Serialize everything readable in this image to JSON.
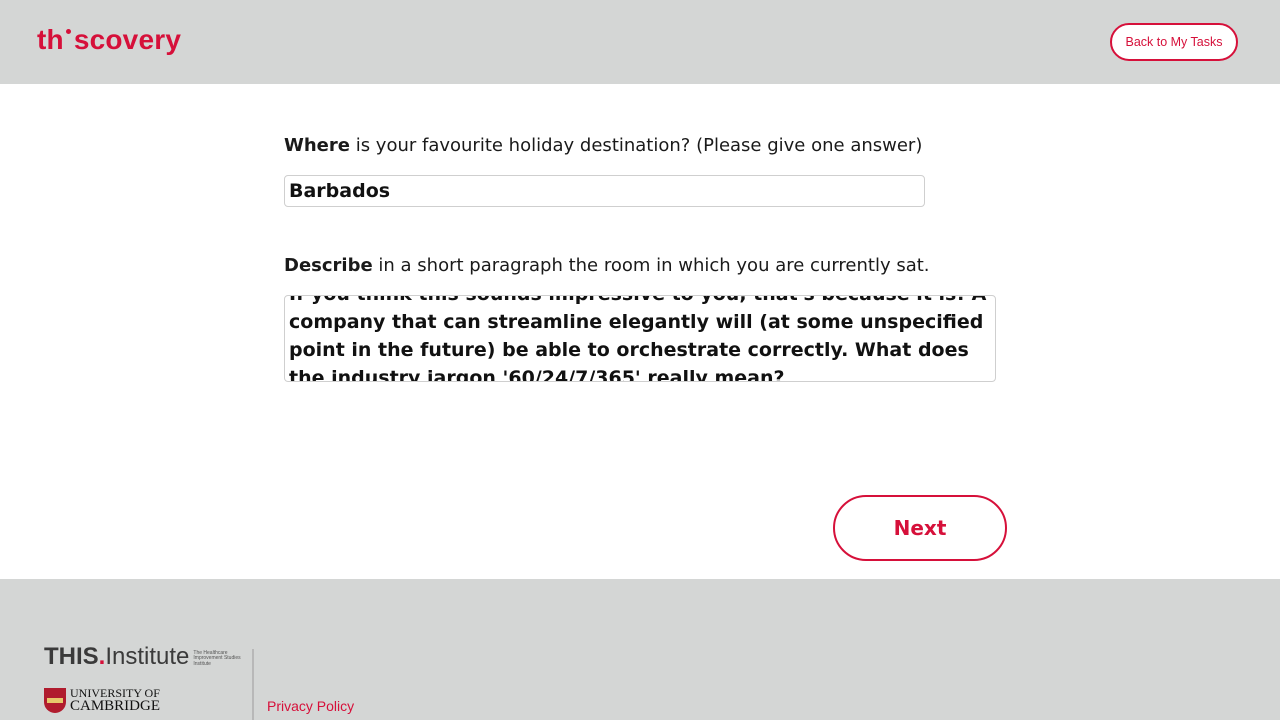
{
  "header": {
    "logo_text_left": "th",
    "logo_text_right": "scovery",
    "back_button_label": "Back to My Tasks"
  },
  "questions": [
    {
      "bold": "Where",
      "rest": " is your favourite holiday destination? (Please give one answer)",
      "answer": "Barbados"
    },
    {
      "bold": "Describe",
      "rest": " in a short paragraph the room in which you are currently sat.",
      "answer": "If you think this sounds impressive to you, that's because it is! A company that can streamline elegantly will (at some unspecified point in the future) be able to orchestrate correctly. What does the industry jargon '60/24/7/365' really mean?"
    }
  ],
  "next_button_label": "Next",
  "footer": {
    "this_bold": "THIS",
    "this_dot": ".",
    "this_rest": "Institute",
    "this_sub": "The Healthcare Improvement Studies Institute",
    "cam_line1": "UNIVERSITY OF",
    "cam_line2": "CAMBRIDGE",
    "privacy_label": "Privacy Policy"
  },
  "colors": {
    "accent": "#d6103a",
    "header_bg": "#d4d6d5"
  },
  "icons": {
    "crest": "university-crest-icon"
  }
}
